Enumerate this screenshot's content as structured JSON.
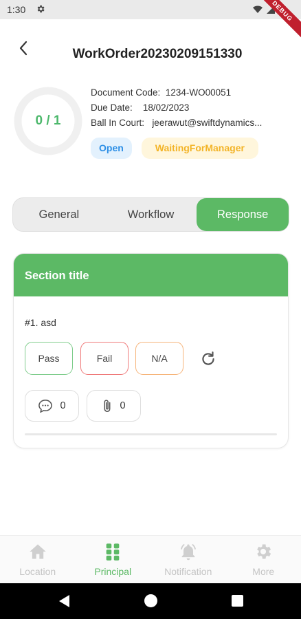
{
  "status_bar": {
    "time": "1:30",
    "debug_label": "DEBUG"
  },
  "header": {
    "title": "WorkOrder20230209151330"
  },
  "progress": {
    "text": "0 / 1",
    "done": 0,
    "total": 1
  },
  "info": {
    "document_code_label": "Document Code:",
    "document_code": "1234-WO00051",
    "due_date_label": "Due Date:",
    "due_date": "18/02/2023",
    "ball_in_court_label": "Ball In Court:",
    "ball_in_court": "jeerawut@swiftdynamics..."
  },
  "badges": {
    "status": "Open",
    "workflow_state": "WaitingForManager"
  },
  "tabs": [
    {
      "label": "General",
      "active": false
    },
    {
      "label": "Workflow",
      "active": false
    },
    {
      "label": "Response",
      "active": true
    }
  ],
  "section": {
    "title": "Section title",
    "question": "#1. asd",
    "options": {
      "pass": "Pass",
      "fail": "Fail",
      "na": "N/A"
    },
    "comment_count": "0",
    "attachment_count": "0"
  },
  "bottom_nav": [
    {
      "label": "Location",
      "icon": "home-icon",
      "active": false
    },
    {
      "label": "Principal",
      "icon": "grid-icon",
      "active": true
    },
    {
      "label": "Notification",
      "icon": "bell-icon",
      "active": false
    },
    {
      "label": "More",
      "icon": "gear-icon",
      "active": false
    }
  ],
  "colors": {
    "primary_green": "#5cb965",
    "open_blue": "#2d8fe6",
    "waiting_yellow": "#f3b428",
    "pass_border": "#7fcd8c",
    "fail_border": "#ef7a7a",
    "na_border": "#f6b47a"
  }
}
